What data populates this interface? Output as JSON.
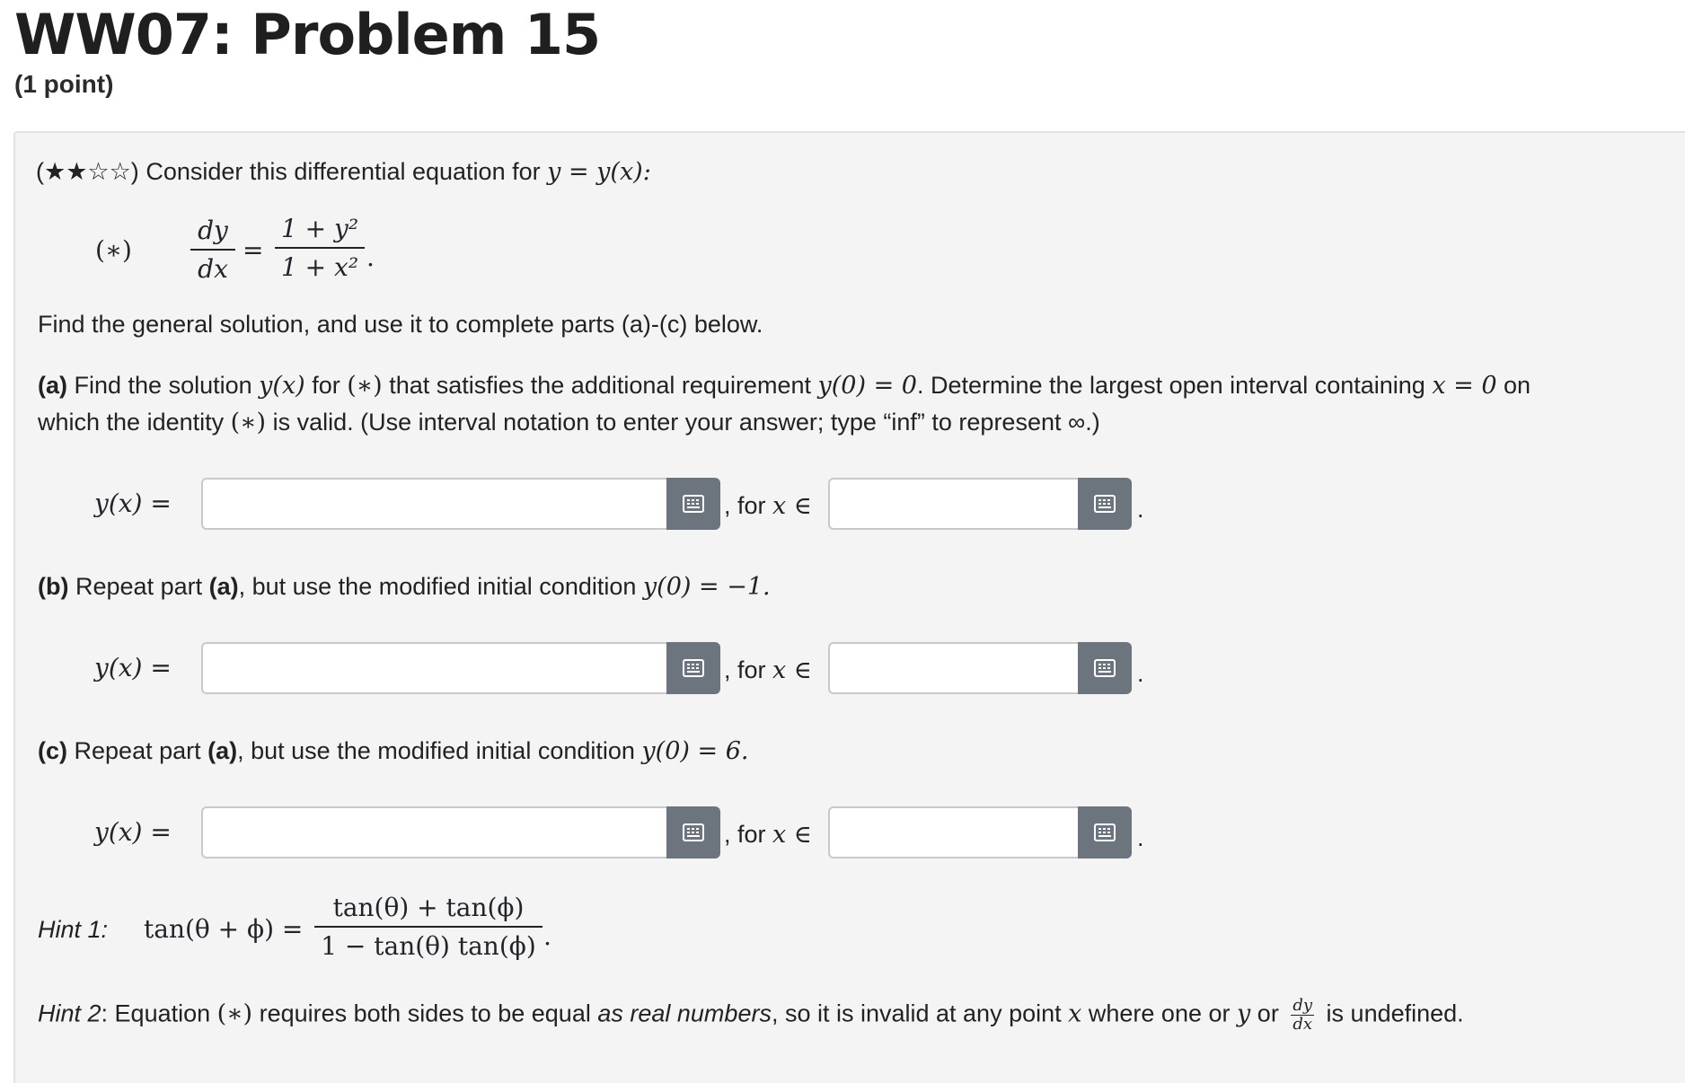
{
  "header": {
    "title": "WW07: Problem 15",
    "points": "(1 point)"
  },
  "problem": {
    "difficulty_stars": "(★★☆☆)",
    "intro_text": "Consider this differential equation for",
    "intro_math": "y = y(x):",
    "equation": {
      "label": "(∗)",
      "lhs_num": "dy",
      "lhs_den": "dx",
      "equals": "=",
      "rhs_num": "1 + y²",
      "rhs_den": "1 + x²",
      "end": "."
    },
    "general_instruction": "Find the general solution, and use it to complete parts (a)-(c) below.",
    "part_a": {
      "label": "(a)",
      "text_line1_a": "Find the solution",
      "math_1": "y(x)",
      "text_line1_b": "for",
      "math_2": "(∗)",
      "text_line1_c": "that satisfies the additional requirement",
      "math_3": "y(0) = 0",
      "text_line1_d": ". Determine the largest open interval containing",
      "math_4": "x = 0",
      "text_line1_e": "on",
      "text_line2_a": "which the identity",
      "math_5": "(∗)",
      "text_line2_b": "is valid. (Use interval notation to enter your answer; type “inf” to represent ∞.)"
    },
    "part_b": {
      "label": "(b)",
      "text_a": "Repeat part",
      "ref": "(a)",
      "text_b": ", but use the modified initial condition",
      "math": "y(0) = −1."
    },
    "part_c": {
      "label": "(c)",
      "text_a": "Repeat part",
      "ref": "(a)",
      "text_b": ", but use the modified initial condition",
      "math": "y(0) = 6."
    },
    "answer_rows": [
      {
        "lhs": "y(x) =",
        "for_text": ", for",
        "in_math": "x ∈",
        "end": ".",
        "value": "",
        "interval_value": ""
      },
      {
        "lhs": "y(x) =",
        "for_text": ", for",
        "in_math": "x ∈",
        "end": ".",
        "value": "",
        "interval_value": ""
      },
      {
        "lhs": "y(x) =",
        "for_text": ", for",
        "in_math": "x ∈",
        "end": ".",
        "value": "",
        "interval_value": ""
      }
    ],
    "hint1": {
      "label": "Hint 1:",
      "lhs": "tan(θ + ϕ) =",
      "num": "tan(θ) + tan(ϕ)",
      "den": "1 − tan(θ) tan(ϕ)",
      "end": "."
    },
    "hint2": {
      "label": "Hint 2",
      "text_a": ": Equation",
      "math_1": "(∗)",
      "text_b": "requires both sides to be equal",
      "emph": "as real numbers",
      "text_c": ", so it is invalid at any point",
      "math_2": "x",
      "text_d": "where one or",
      "math_3": "y",
      "text_e": "or",
      "frac_num": "dy",
      "frac_den": "dx",
      "text_f": "is undefined."
    }
  },
  "icons": {
    "equation_editor": "grid-icon"
  },
  "colors": {
    "button_bg": "#6c757d",
    "panel_bg": "#f4f4f4"
  }
}
